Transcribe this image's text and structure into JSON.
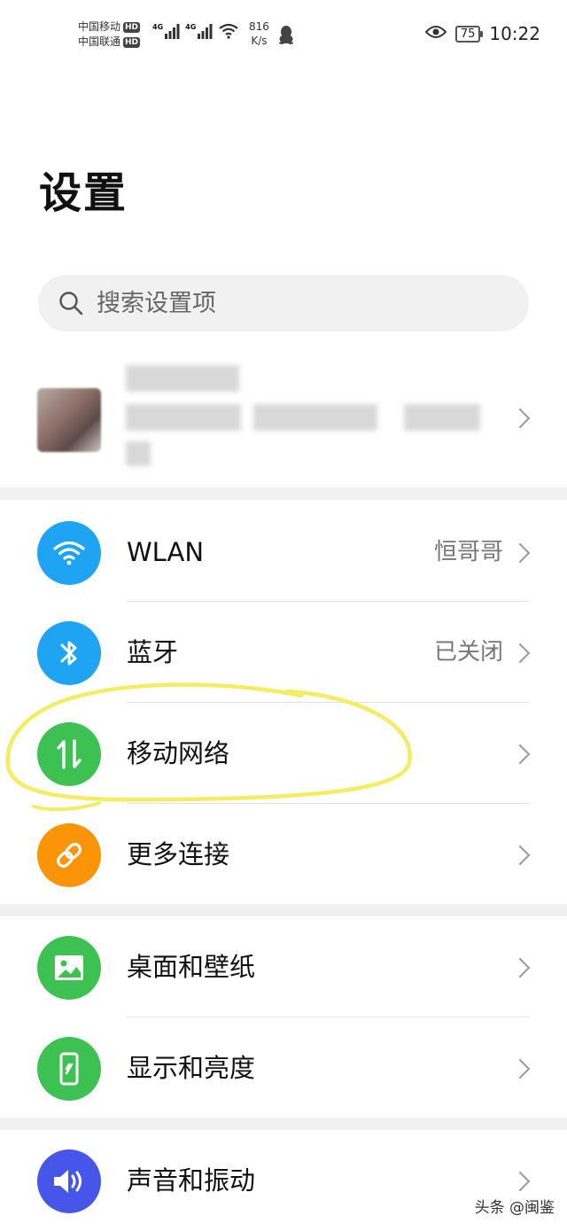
{
  "status_bar": {
    "carrier1": "中国移动",
    "carrier2": "中国联通",
    "hd_badge": "HD",
    "network_type": "4G",
    "speed_value": "816",
    "speed_unit": "K/s",
    "battery": "75",
    "time": "10:22"
  },
  "page": {
    "title": "设置"
  },
  "search": {
    "placeholder": "搜索设置项"
  },
  "sections": [
    {
      "items": [
        {
          "label": "WLAN",
          "value": "恒哥哥",
          "icon": "wifi-icon",
          "color": "#1ea4f2"
        },
        {
          "label": "蓝牙",
          "value": "已关闭",
          "icon": "bluetooth-icon",
          "color": "#1ea4f2"
        },
        {
          "label": "移动网络",
          "value": "",
          "icon": "mobile-data-icon",
          "color": "#3cc152"
        },
        {
          "label": "更多连接",
          "value": "",
          "icon": "link-icon",
          "color": "#fb9406"
        }
      ]
    },
    {
      "items": [
        {
          "label": "桌面和壁纸",
          "value": "",
          "icon": "image-icon",
          "color": "#3cc152"
        },
        {
          "label": "显示和亮度",
          "value": "",
          "icon": "phone-brightness-icon",
          "color": "#3cc152"
        }
      ]
    },
    {
      "items": [
        {
          "label": "声音和振动",
          "value": "",
          "icon": "speaker-icon",
          "color": "#4556e8"
        }
      ]
    }
  ],
  "watermark": "头条 @闽鉴",
  "annotation_color": "#f4ec62"
}
